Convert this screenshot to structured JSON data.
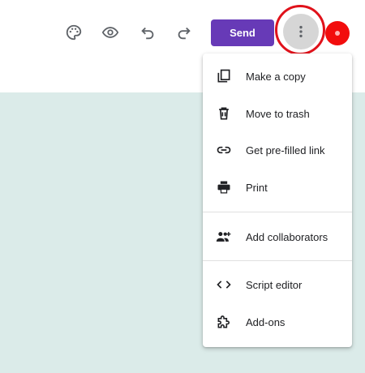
{
  "toolbar": {
    "icons": [
      "palette-icon",
      "eye-icon",
      "undo-icon",
      "redo-icon"
    ],
    "send_label": "Send",
    "more_icon": "more-vert-icon"
  },
  "menu": {
    "items": [
      {
        "label": "Make a copy",
        "icon": "copy-icon"
      },
      {
        "label": "Move to trash",
        "icon": "trash-icon"
      },
      {
        "label": "Get pre-filled link",
        "icon": "link-icon"
      },
      {
        "label": "Print",
        "icon": "print-icon"
      },
      {
        "label": "Add collaborators",
        "icon": "add-people-icon"
      },
      {
        "label": "Script editor",
        "icon": "code-icon"
      },
      {
        "label": "Add-ons",
        "icon": "puzzle-icon"
      }
    ]
  },
  "colors": {
    "send_button": "#673ab7",
    "canvas_background": "#dbebe9",
    "highlight_ring": "#e0121b",
    "avatar": "#f20d0d"
  }
}
